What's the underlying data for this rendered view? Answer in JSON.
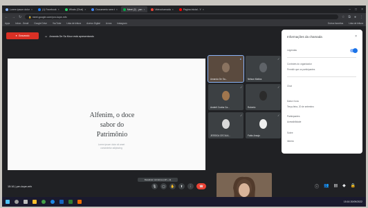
{
  "browser": {
    "tabs": [
      {
        "label": "Lorem ipsum dolor"
      },
      {
        "label": "(1) Facebook"
      },
      {
        "label": "Whats (Chat)"
      },
      {
        "label": "Documento sem t"
      },
      {
        "label": "Meet (2) - yxn"
      },
      {
        "label": "Videochamada"
      },
      {
        "label": "Página inicial - Y"
      }
    ],
    "url": "meet.google.com/yxn-kcpe-mfx",
    "bookmarks": [
      "Apps",
      "Inbox - Gmail",
      "Google Drive",
      "YouTube",
      "Lista de leitura",
      "Acervo Digital",
      "Livros",
      "Instagram"
    ],
    "bookmarks_right": [
      "Outros favoritos",
      "Lista de leitura"
    ]
  },
  "meet": {
    "live_badge": "Gravando",
    "presenting_text": "Amanda De Sa Mour está apresentando",
    "slide": {
      "title_line1": "Alfenim, o doce",
      "title_line2": "sabor do",
      "title_line3": "Patrimônio",
      "subtitle_line1": "Lorem ipsum dolor sit amet",
      "subtitle_line2": "consectetur adipiscing"
    },
    "participants": [
      {
        "name": "Amanda De Sa..."
      },
      {
        "name": "Nelson Mattos"
      },
      {
        "name": "Anderli Cunha Ca..."
      },
      {
        "name": "Roberto"
      },
      {
        "name": "JESSICA CECILIA..."
      },
      {
        "name": "Fabio Araujo"
      }
    ],
    "clock": "15:16  |  yxn-kcpe-mfx",
    "tooltip": "Desativar microfone (ctrl + d)",
    "panel": {
      "title": "Informações da chamada",
      "rows": [
        "Legendas",
        "Controles do organizador",
        "Permitir que os participantes",
        "Chat",
        "Data e hora",
        "Terça-feira, 20 de setembro",
        "Participantes",
        "Acessibilidade",
        "Sobre",
        "Idioma"
      ]
    }
  },
  "taskbar": {
    "tray_text": "15:16  20/09/2022"
  }
}
